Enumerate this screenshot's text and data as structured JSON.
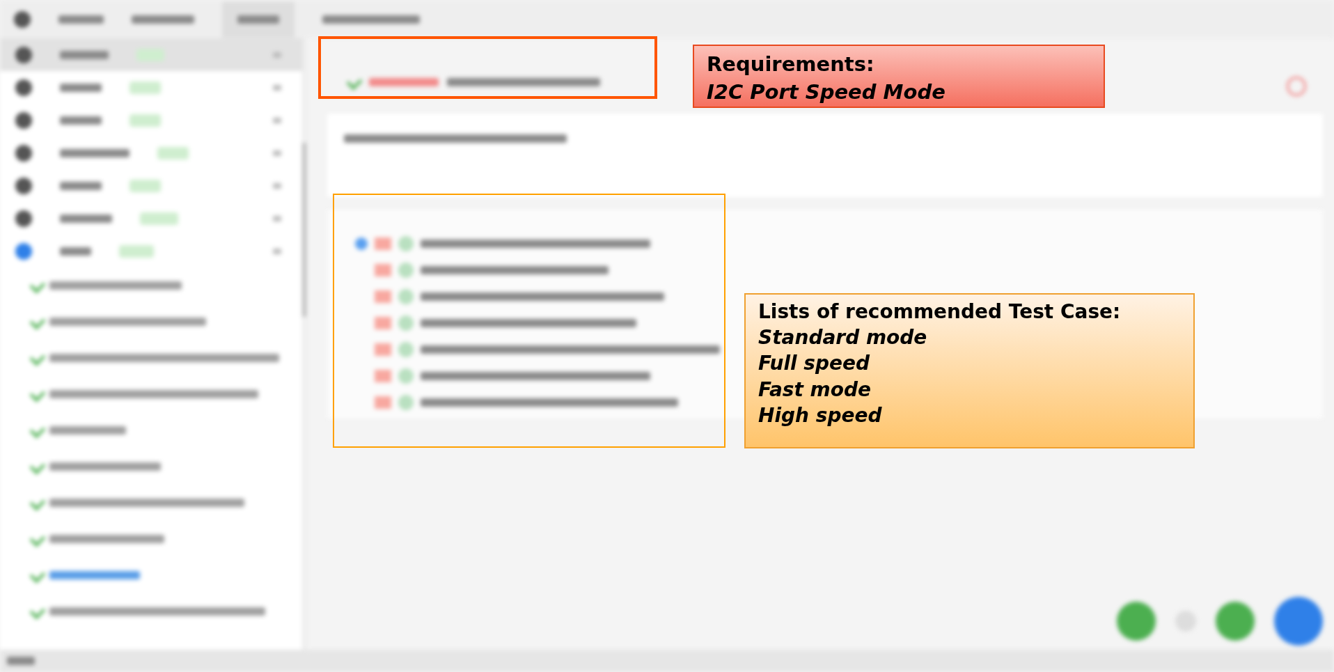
{
  "callouts": [
    {
      "kind": "requirements",
      "lines": [
        {
          "text": "Requirements:",
          "italic": false
        },
        {
          "text": "I2C Port Speed Mode",
          "italic": true
        }
      ]
    },
    {
      "kind": "test_cases",
      "lines": [
        {
          "text": "Lists of recommended Test Case:",
          "italic": false
        },
        {
          "text": "Standard mode",
          "italic": true
        },
        {
          "text": "Full speed",
          "italic": true
        },
        {
          "text": "Fast mode",
          "italic": true
        },
        {
          "text": "High speed",
          "italic": true
        }
      ]
    }
  ]
}
